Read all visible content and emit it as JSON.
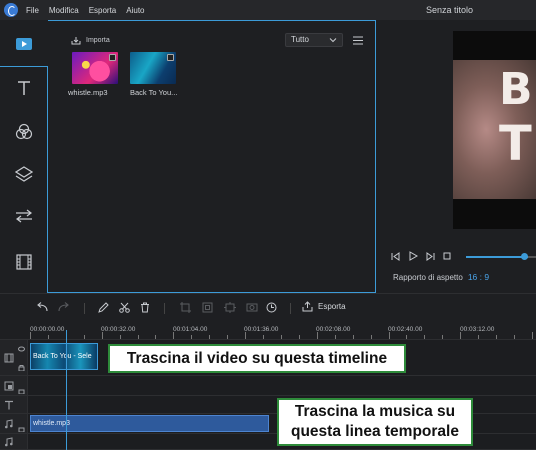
{
  "titlebar": {
    "menu": [
      "File",
      "Modifica",
      "Esporta",
      "Aiuto"
    ],
    "window_title": "Senza titolo"
  },
  "sidebar": {
    "items": [
      {
        "icon": "media-icon"
      },
      {
        "icon": "text-icon"
      },
      {
        "icon": "filters-icon"
      },
      {
        "icon": "overlays-icon"
      },
      {
        "icon": "transitions-icon"
      },
      {
        "icon": "film-icon"
      }
    ]
  },
  "media": {
    "import_label": "Importa",
    "filter_value": "Tutto",
    "items": [
      {
        "label": "whistle.mp3",
        "type": "audio"
      },
      {
        "label": "Back To You...",
        "type": "video"
      }
    ]
  },
  "preview": {
    "aspect_label": "Rapporto di aspetto",
    "aspect_value": "16 : 9",
    "progress_fraction": 0.84
  },
  "toolbar": {
    "export_label": "Esporta"
  },
  "ruler": {
    "ticks": [
      "00:00:00.00",
      "00:00:32.00",
      "00:01:04.00",
      "00:01:36.00",
      "00:02:08.00",
      "00:02:40.00",
      "00:03:12.00"
    ]
  },
  "timeline": {
    "video_clip_label": "Back To You - Sele",
    "audio_clip_label": "whistle.mp3"
  },
  "callouts": {
    "video": "Trascina il video su questa timeline",
    "music_line1": "Trascina la musica su",
    "music_line2": "questa linea temporale"
  },
  "colors": {
    "accent": "#3c9bd8",
    "audio_clip": "#2e5a9c",
    "callout_border": "#2e8b3a"
  }
}
